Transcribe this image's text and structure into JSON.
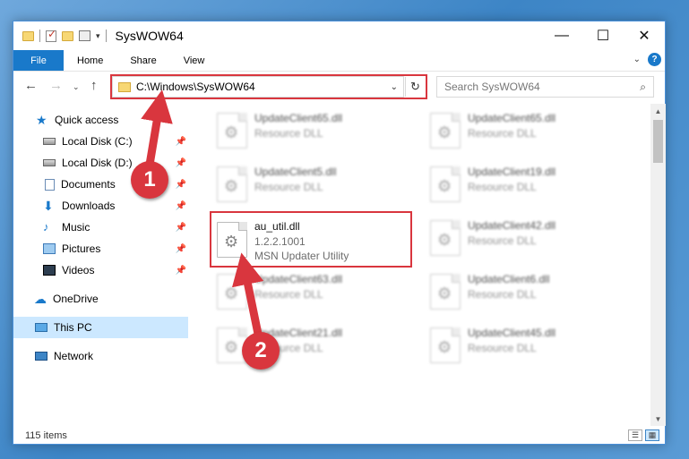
{
  "window": {
    "title": "SysWOW64"
  },
  "controls": {
    "minimize": "—",
    "maximize": "☐",
    "close": "✕"
  },
  "ribbon": {
    "tabs": [
      "File",
      "Home",
      "Share",
      "View"
    ],
    "help": "?"
  },
  "nav": {
    "address": "C:\\Windows\\SysWOW64",
    "search_placeholder": "Search SysWOW64"
  },
  "sidebar": {
    "items": [
      {
        "label": "Quick access",
        "icon": "star-icon",
        "pinned": false
      },
      {
        "label": "Local Disk (C:)",
        "icon": "disk-icon",
        "pinned": true
      },
      {
        "label": "Local Disk (D:)",
        "icon": "disk-icon",
        "pinned": true
      },
      {
        "label": "Documents",
        "icon": "documents-icon",
        "pinned": true
      },
      {
        "label": "Downloads",
        "icon": "download-icon",
        "pinned": true
      },
      {
        "label": "Music",
        "icon": "music-icon",
        "pinned": true
      },
      {
        "label": "Pictures",
        "icon": "pictures-icon",
        "pinned": true
      },
      {
        "label": "Videos",
        "icon": "videos-icon",
        "pinned": true
      },
      {
        "label": "OneDrive",
        "icon": "onedrive-icon",
        "pinned": false
      },
      {
        "label": "This PC",
        "icon": "this-pc-icon",
        "pinned": false,
        "selected": true
      },
      {
        "label": "Network",
        "icon": "network-icon",
        "pinned": false
      }
    ]
  },
  "files": [
    {
      "name": "UpdateClient65.dll",
      "type": "Resource DLL"
    },
    {
      "name": "UpdateClient65.dll",
      "type": "Resource DLL"
    },
    {
      "name": "UpdateClient5.dll",
      "type": "Resource DLL"
    },
    {
      "name": "UpdateClient19.dll",
      "type": "Resource DLL"
    },
    {
      "name": "au_util.dll",
      "version": "1.2.2.1001",
      "description": "MSN Updater Utility",
      "highlighted": true
    },
    {
      "name": "UpdateClient42.dll",
      "type": "Resource DLL"
    },
    {
      "name": "UpdateClient63.dll",
      "type": "Resource DLL"
    },
    {
      "name": "UpdateClient6.dll",
      "type": "Resource DLL"
    },
    {
      "name": "UpdateClient21.dll",
      "type": "Resource DLL"
    },
    {
      "name": "UpdateClient45.dll",
      "type": "Resource DLL"
    }
  ],
  "status": {
    "count": "115 items"
  },
  "annotations": {
    "step1": "1",
    "step2": "2",
    "color": "#d9363e"
  }
}
